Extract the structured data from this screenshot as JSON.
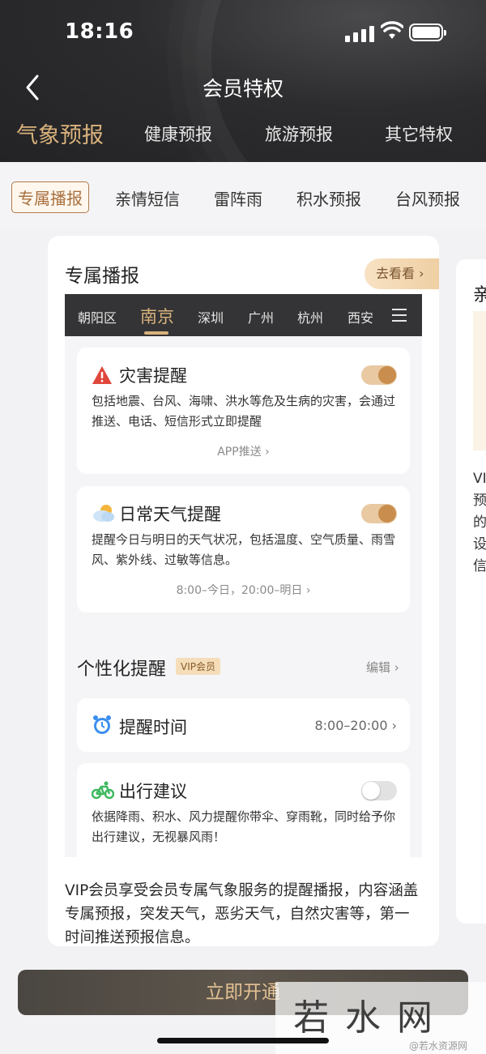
{
  "status_bar": {
    "time": "18:16"
  },
  "nav": {
    "title": "会员特权"
  },
  "top_tabs": [
    "气象预报",
    "健康预报",
    "旅游预报",
    "其它特权"
  ],
  "sub_tabs": [
    "专属播报",
    "亲情短信",
    "雷阵雨",
    "积水预报",
    "台风预报"
  ],
  "card": {
    "title": "专属播报",
    "look_button": "去看看",
    "cities": [
      "朝阳区",
      "南京",
      "深圳",
      "广州",
      "杭州",
      "西安"
    ],
    "disaster": {
      "title": "灾害提醒",
      "desc": "包括地震、台风、海啸、洪水等危及生病的灾害，会通过推送、电话、短信形式立即提醒",
      "link": "APP推送"
    },
    "daily": {
      "title": "日常天气提醒",
      "desc": "提醒今日与明日的天气状况，包括温度、空气质量、雨雪风、紫外线、过敏等信息。",
      "link": "8:00–今日，20:00–明日"
    },
    "personal": {
      "title": "个性化提醒",
      "badge": "VIP会员",
      "edit": "编辑"
    },
    "remind_time": {
      "label": "提醒时间",
      "value": "8:00–20:00"
    },
    "travel": {
      "title": "出行建议",
      "desc": "依据降雨、积水、风力提醒你带伞、穿雨靴，同时给予你出行建议，无视暴风雨！"
    },
    "description": "VIP会员享受会员专属气象服务的提醒播报，内容涵盖专属预报，突发天气，恶劣天气，自然灾害等，第一时间推送预报信息。"
  },
  "peek_card": {
    "title": "亲",
    "text_lines": [
      "VI",
      "预",
      "的",
      "设",
      "信"
    ]
  },
  "cta": {
    "label": "立即开通"
  },
  "watermark": {
    "text": "若水网",
    "small": "@若水资源网"
  },
  "colors": {
    "accent": "#d9b27c",
    "dark": "#2c2c2e",
    "brown": "#a8703f"
  }
}
